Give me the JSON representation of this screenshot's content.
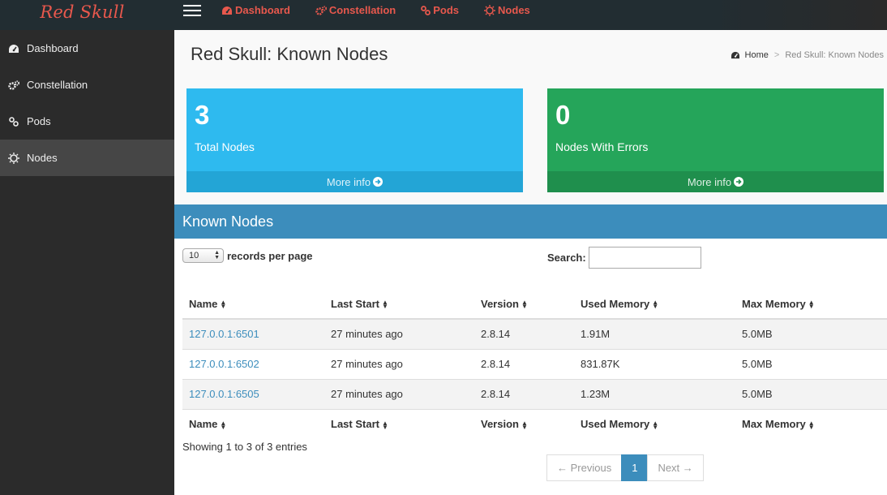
{
  "brand": "Red Skull",
  "topnav": [
    {
      "label": "Dashboard",
      "icon": "dashboard-icon"
    },
    {
      "label": "Constellation",
      "icon": "gears-icon"
    },
    {
      "label": "Pods",
      "icon": "link-icon"
    },
    {
      "label": "Nodes",
      "icon": "sun-icon"
    }
  ],
  "sidebar": {
    "items": [
      {
        "label": "Dashboard",
        "icon": "dashboard-icon"
      },
      {
        "label": "Constellation",
        "icon": "gears-icon"
      },
      {
        "label": "Pods",
        "icon": "link-icon"
      },
      {
        "label": "Nodes",
        "icon": "sun-icon",
        "active": true
      }
    ]
  },
  "page": {
    "title": "Red Skull: Known Nodes",
    "breadcrumb": {
      "home": "Home",
      "sep": ">",
      "current": "Red Skull: Known Nodes"
    }
  },
  "stats": [
    {
      "value": "3",
      "label": "Total Nodes",
      "more": "More info",
      "color": "#2ebaef"
    },
    {
      "value": "0",
      "label": "Nodes With Errors",
      "more": "More info",
      "color": "#25a55a"
    }
  ],
  "panel": {
    "title": "Known Nodes",
    "length_value": "10",
    "length_label": "records per page",
    "search_label": "Search:",
    "search_value": "",
    "columns": [
      "Name",
      "Last Start",
      "Version",
      "Used Memory",
      "Max Memory"
    ],
    "rows": [
      [
        "127.0.0.1:6501",
        "27 minutes ago",
        "2.8.14",
        "1.91M",
        "5.0MB"
      ],
      [
        "127.0.0.1:6502",
        "27 minutes ago",
        "2.8.14",
        "831.87K",
        "5.0MB"
      ],
      [
        "127.0.0.1:6505",
        "27 minutes ago",
        "2.8.14",
        "1.23M",
        "5.0MB"
      ]
    ],
    "info": "Showing 1 to 3 of 3 entries",
    "pager": {
      "prev": "← Previous",
      "current": "1",
      "next": "Next →"
    }
  },
  "colors": {
    "brand": "#e8584d",
    "header": "#3c8dbc",
    "sidebar": "#2b2b2b"
  }
}
